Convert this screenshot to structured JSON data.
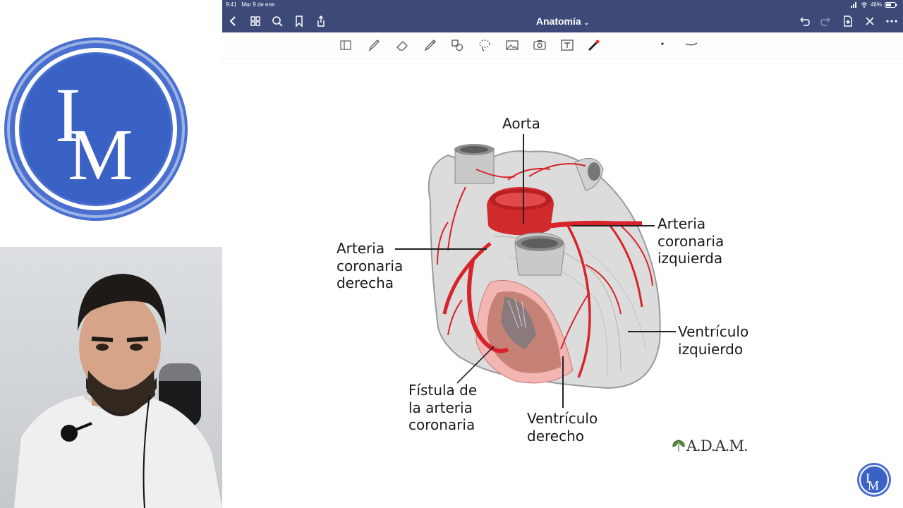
{
  "status": {
    "time": "9:41",
    "date": "Mar 9 de ene",
    "battery": "46%"
  },
  "header": {
    "title": "Anatomía"
  },
  "logo": {
    "text": "IM"
  },
  "diagram": {
    "labels": {
      "aorta": "Aorta",
      "left_coronary": [
        "Arteria",
        "coronaria",
        "izquierda"
      ],
      "right_coronary": [
        "Arteria",
        "coronaria",
        "derecha"
      ],
      "left_ventricle": [
        "Ventrículo",
        "izquierdo"
      ],
      "right_ventricle": [
        "Ventrículo",
        "derecho"
      ],
      "fistula": [
        "Fístula de",
        "la arteria",
        "coronaria"
      ]
    },
    "credit": "A.D.A.M."
  },
  "colors": {
    "nav": "#3d4a78",
    "logo_blue": "#3f6fd0",
    "artery": "#d8232a"
  }
}
